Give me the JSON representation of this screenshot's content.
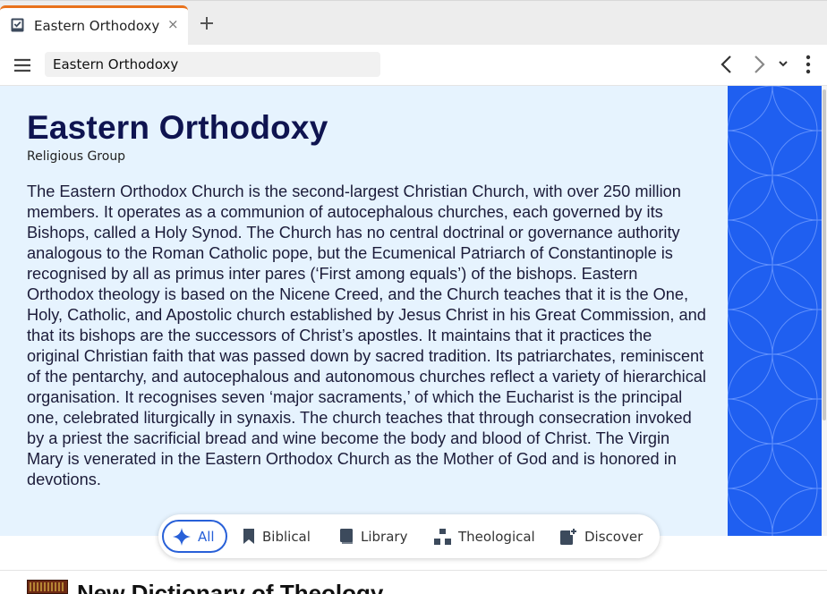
{
  "tab": {
    "label": "Eastern Orthodoxy",
    "icon": "notebook-check-icon",
    "close_glyph": "×",
    "accent_color": "#e8721c"
  },
  "toolbar": {
    "address": "Eastern Orthodoxy"
  },
  "article": {
    "title": "Eastern Orthodoxy",
    "subtitle": "Religious Group",
    "body": "The Eastern Orthodox Church is the second-largest Christian Church, with over 250 million members. It operates as a communion of autocephalous churches, each governed by its Bishops, called a Holy Synod. The Church has no central doctrinal or governance authority analogous to the Roman Catholic pope, but the Ecumenical Patriarch of Constantinople is recognised by all as primus inter pares (‘First among equals’) of the bishops. Eastern Orthodox theology is based on the Nicene Creed, and the Church teaches that it is the One, Holy, Catholic, and Apostolic church established by Jesus Christ in his Great Commission, and that its bishops are the successors of Christ’s apostles. It maintains that it practices the original Christian faith that was passed down by sacred tradition. Its patriarchates, reminiscent of the pentarchy, and autocephalous and autonomous churches reflect a variety of hierarchical organisation. It recognises seven ‘major sacraments,’ of which the Eucharist is the principal one, celebrated liturgically in synaxis. The church teaches that through consecration invoked by a priest the sacrificial bread and wine become the body and blood of Christ. The Virgin Mary is venerated in the Eastern Orthodox Church as the Mother of God and is honored in devotions.",
    "pattern_color": "#1f5ff0"
  },
  "filters": {
    "all": "All",
    "biblical": "Biblical",
    "library": "Library",
    "theological": "Theological",
    "discover": "Discover",
    "active_color": "#2860d8"
  },
  "results": {
    "first_heading": "New Dictionary of Theology"
  }
}
